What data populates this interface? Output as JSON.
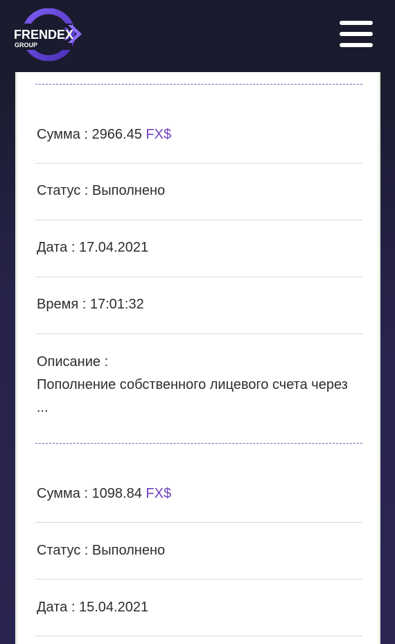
{
  "header": {
    "logo_text": "FRENDEX",
    "logo_subtext": "GROUP",
    "menu_icon": "hamburger-menu-icon"
  },
  "labels": {
    "amount": "Сумма :",
    "status": "Статус :",
    "date": "Дата :",
    "time": "Время :",
    "description": "Описание :"
  },
  "transactions": [
    {
      "amount": "2966.45",
      "currency": "FX$",
      "status": "Выполнено",
      "date": "17.04.2021",
      "time": "17:01:32",
      "description": "Пополнение собственного лицевого счета через ..."
    },
    {
      "amount": "1098.84",
      "currency": "FX$",
      "status": "Выполнено",
      "date": "15.04.2021"
    }
  ],
  "colors": {
    "header_bg": "#1a1b2e",
    "accent": "#6f42c1",
    "logo_ring": "#6a45d8"
  }
}
